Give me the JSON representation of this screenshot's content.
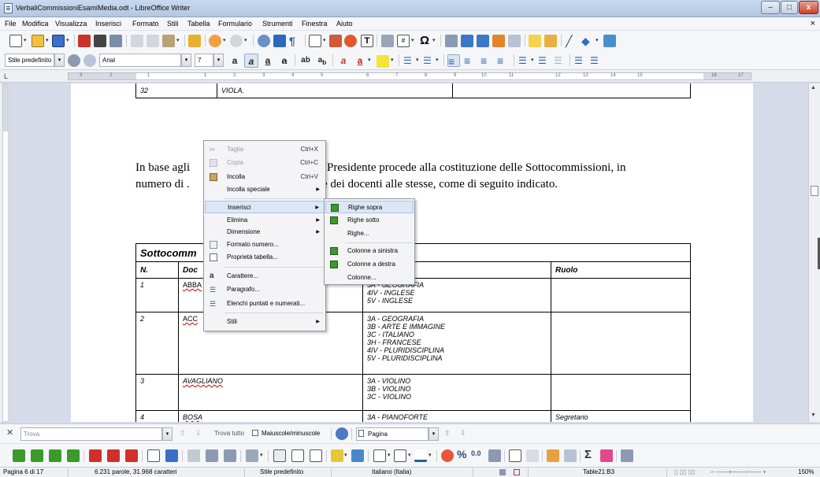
{
  "window": {
    "title": "VerbaliCommissioniEsamiMedia.odt - LibreOffice Writer",
    "doc_close": "×",
    "buttons": {
      "minimize": "–",
      "maximize": "□",
      "close": "x"
    }
  },
  "menu": [
    "File",
    "Modifica",
    "Visualizza",
    "Inserisci",
    "Formato",
    "Stili",
    "Tabella",
    "Formulario",
    "Strumenti",
    "Finestra",
    "Aiuto"
  ],
  "format_toolbar": {
    "paragraph_style": "Stile predefinito",
    "font_name": "Arial",
    "font_size": "7"
  },
  "ruler": {
    "corner": "L",
    "numbers": [
      "3",
      "2",
      "1",
      "1",
      "2",
      "3",
      "4",
      "5",
      "6",
      "7",
      "8",
      "9",
      "10",
      "11",
      "12",
      "13",
      "14",
      "15",
      "16",
      "17"
    ]
  },
  "document": {
    "top_row": {
      "number": "32",
      "name": "VIOLA."
    },
    "paragraph_line1_start": "In base agli",
    "paragraph_line1_end": "Presidente procede alla costituzione delle Sottocommissioni, in",
    "paragraph_line2_start": "numero di .",
    "paragraph_line2_end": "e dei docenti alle stesse, come di seguito indicato.",
    "table_title": "Sottocomm",
    "headers": {
      "n": "N.",
      "docente": "Doc",
      "ruolo": "Ruolo"
    },
    "rows": [
      {
        "n": "1",
        "name": "ABBA",
        "classes": [
          "3A - GEOGRAFIA",
          "4IV - INGLESE",
          "5V - INGLESE"
        ],
        "role": ""
      },
      {
        "n": "2",
        "name": "ACC",
        "classes": [
          "3A - GEOGRAFIA",
          "3B - ARTE E IMMAGINE",
          "3C - ITALIANO",
          "3H - FRANCESE",
          "4IV - PLURIDISCIPLINA",
          "5V - PLURIDISCIPLINA"
        ],
        "role": ""
      },
      {
        "n": "3",
        "name": "AVAGLIANO",
        "classes": [
          "3A - VIOLINO",
          "3B - VIOLINO",
          "3C - VIOLINO"
        ],
        "role": ""
      },
      {
        "n": "4",
        "name": "BOSA",
        "classes": [
          "3A - PIANOFORTE"
        ],
        "role": "Segretario"
      }
    ]
  },
  "context_menu": {
    "items": [
      {
        "label": "Taglia",
        "shortcut": "Ctrl+X",
        "disabled": true,
        "icon": "scissors-icon"
      },
      {
        "label": "Copia",
        "shortcut": "Ctrl+C",
        "disabled": true,
        "icon": "copy-icon"
      },
      {
        "label": "Incolla",
        "shortcut": "Ctrl+V",
        "disabled": false,
        "icon": "paste-icon"
      },
      {
        "label": "Incolla speciale",
        "submenu": true
      },
      {
        "label": "Inserisci",
        "submenu": true,
        "highlight": true
      },
      {
        "label": "Elimina",
        "submenu": true
      },
      {
        "label": "Dimensione",
        "submenu": true
      },
      {
        "label": "Formato numero...",
        "icon": "number-format-icon"
      },
      {
        "label": "Proprietà tabella...",
        "icon": "table-properties-icon"
      },
      {
        "label": "Carattere...",
        "icon": "character-icon"
      },
      {
        "label": "Paragrafo...",
        "icon": "paragraph-icon"
      },
      {
        "label": "Elenchi puntati e numerati...",
        "icon": "bullets-icon"
      },
      {
        "label": "Stili",
        "submenu": true
      }
    ]
  },
  "submenu": {
    "items": [
      {
        "label": "Righe sopra",
        "highlight": true,
        "icon": "rows-above-icon"
      },
      {
        "label": "Righe sotto",
        "icon": "rows-below-icon"
      },
      {
        "label": "Righe..."
      },
      {
        "label": "Colonne a sinistra",
        "icon": "columns-left-icon"
      },
      {
        "label": "Colonne a destra",
        "icon": "columns-right-icon"
      },
      {
        "label": "Colonne..."
      }
    ]
  },
  "findbar": {
    "close": "✕",
    "placeholder": "Trova",
    "find_all": "Trova tutto",
    "match_case": "Maiuscole/minuscole",
    "search_in": "Pagina"
  },
  "status": {
    "page": "Pagina 6 di 17",
    "words": "6.231 parole, 31.968 caratteri",
    "style": "Stile predefinito",
    "language": "Italiano (Italia)",
    "cell": "Table21:B3",
    "zoom": "150%"
  },
  "colors": {
    "titlebar": "#c9d9ee",
    "menu_highlight": "#dbe7f6",
    "green_table_icon": "#3a9a2a",
    "red_table_icon": "#d0302a"
  }
}
